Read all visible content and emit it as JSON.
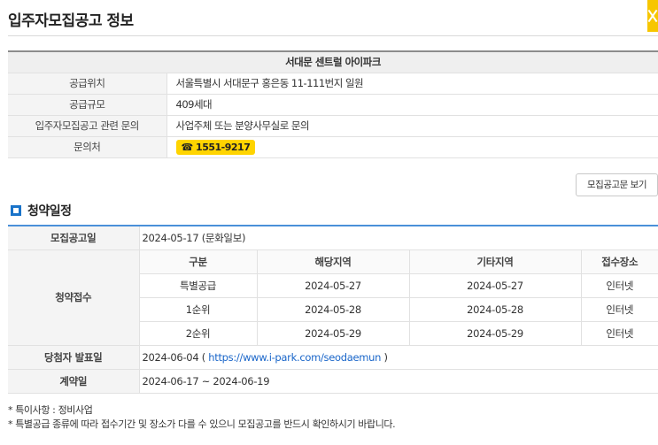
{
  "header": {
    "title": "입주자모집공고 정보"
  },
  "complex": {
    "name": "서대문 센트럴 아이파크",
    "rows": [
      {
        "label": "공급위치",
        "value": "서울특별시 서대문구 홍은동 11-111번지 일원"
      },
      {
        "label": "공급규모",
        "value": "409세대"
      },
      {
        "label": "입주자모집공고 관련 문의",
        "value": "사업주체 또는 분양사무실로 문의"
      }
    ],
    "contact": {
      "label": "문의처",
      "phone_icon": "☎",
      "phone": "1551-9217"
    }
  },
  "notice_button": "모집공고문 보기",
  "schedule": {
    "title": "청약일정",
    "announce": {
      "label": "모집공고일",
      "value": "2024-05-17 (문화일보)"
    },
    "reception": {
      "label": "청약접수",
      "headers": [
        "구분",
        "해당지역",
        "기타지역",
        "접수장소"
      ],
      "rows": [
        [
          "특별공급",
          "2024-05-27",
          "2024-05-27",
          "인터넷"
        ],
        [
          "1순위",
          "2024-05-28",
          "2024-05-28",
          "인터넷"
        ],
        [
          "2순위",
          "2024-05-29",
          "2024-05-29",
          "인터넷"
        ]
      ]
    },
    "winners": {
      "label": "당첨자 발표일",
      "date": "2024-06-04",
      "open_paren": " ( ",
      "link": "https://www.i-park.com/seodaemun",
      "close_paren": " )"
    },
    "contract": {
      "label": "계약일",
      "value": "2024-06-17 ~ 2024-06-19"
    }
  },
  "notes": [
    "* 특이사항 : 정비사업",
    "* 특별공급 종류에 따라 접수기간 및 장소가 다를 수 있으니 모집공고를 반드시 확인하시기 바랍니다."
  ],
  "colors": {
    "accent": "#1a73c9",
    "badge": "#ffd400",
    "close_tab": "#f7c600"
  }
}
